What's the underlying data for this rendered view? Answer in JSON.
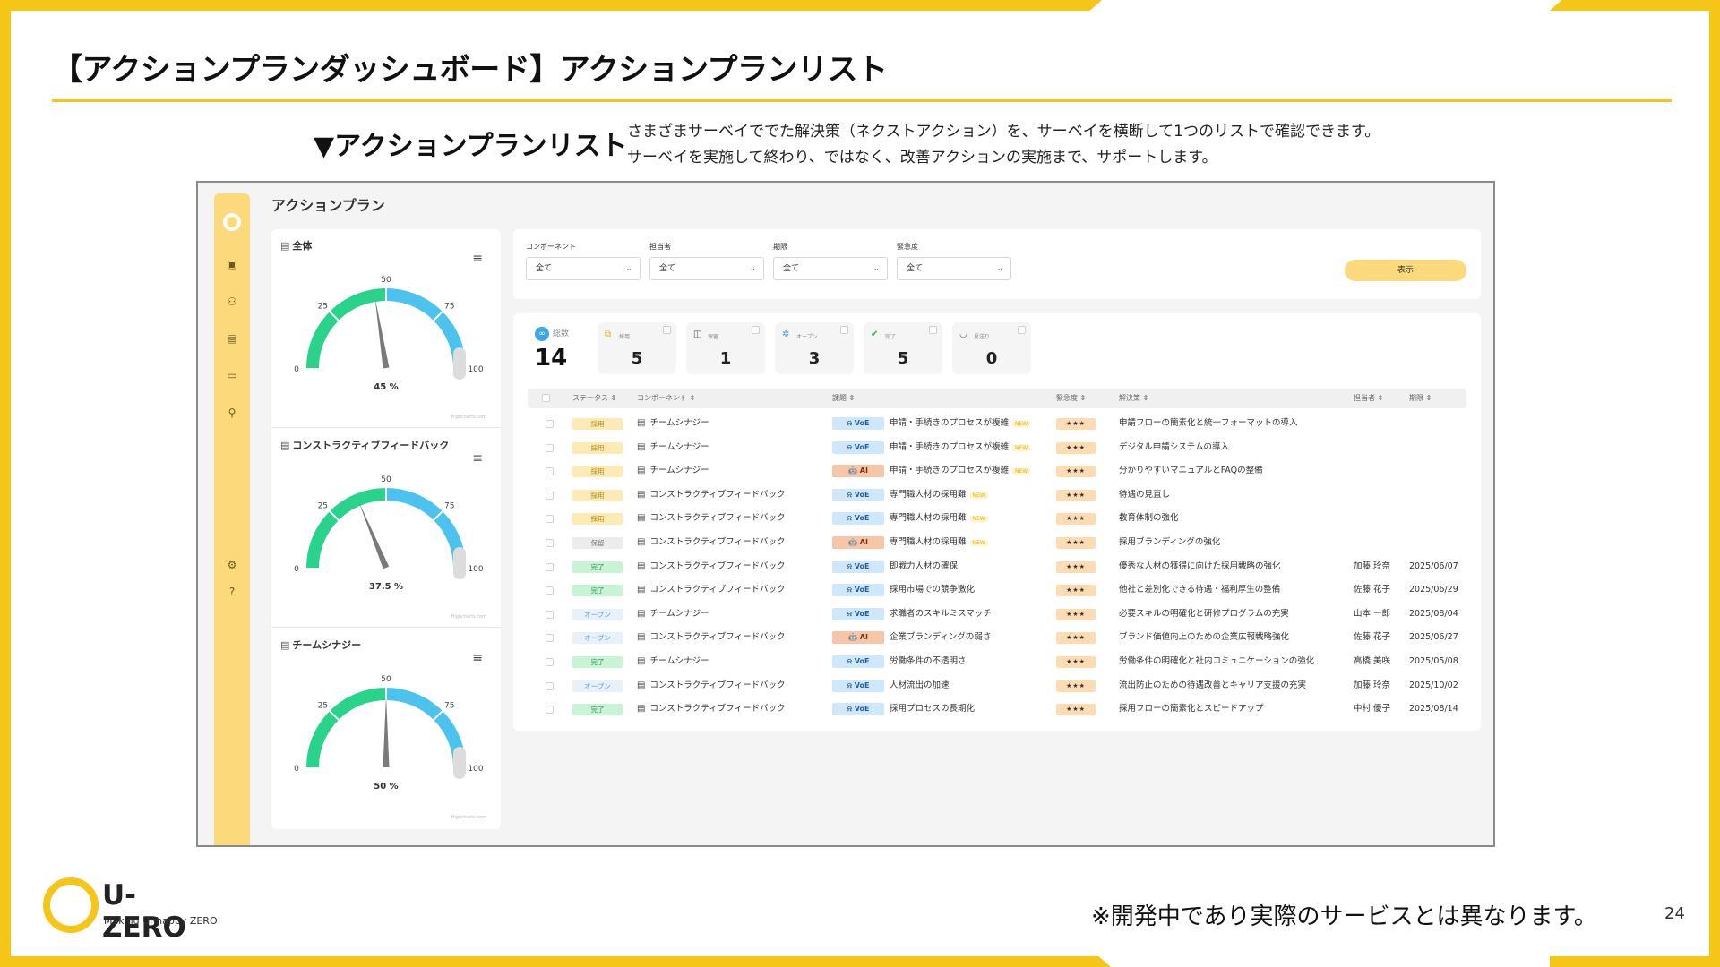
{
  "slide": {
    "title": "【アクションプランダッシュボード】アクションプランリスト",
    "section_heading": "▼アクションプランリスト",
    "description_line1": "さまざまサーベイででた解決策（ネクストアクション）を、サーベイを横断して1つのリストで確認できます。",
    "description_line2": "サーベイを実施して終わり、ではなく、改善アクションの実施まで、サポートします。",
    "footnote": "※開発中であり実際のサービスとは異なります。",
    "page_number": "24",
    "logo": {
      "name": "U-ZERO",
      "tagline": "Making Unhappy ZERO"
    }
  },
  "app": {
    "title": "アクションプラン",
    "sidebar_icons": [
      "calendar-icon",
      "group-icon",
      "survey-icon",
      "chat-icon",
      "people-search-icon",
      "gear-icon",
      "help-icon"
    ]
  },
  "gauges": [
    {
      "name": "全体",
      "value": 45,
      "label": "45 %",
      "ticks": [
        "0",
        "25",
        "50",
        "75",
        "100"
      ],
      "credit": "Highcharts.com"
    },
    {
      "name": "コンストラクティブフィードバック",
      "value": 37.5,
      "label": "37.5 %",
      "ticks": [
        "0",
        "25",
        "50",
        "75",
        "100"
      ],
      "credit": "Highcharts.com"
    },
    {
      "name": "チームシナジー",
      "value": 50,
      "label": "50 %",
      "ticks": [
        "0",
        "25",
        "50",
        "75",
        "100"
      ],
      "credit": "Highcharts.com"
    }
  ],
  "filters": [
    {
      "label": "コンポーネント",
      "value": "全て"
    },
    {
      "label": "担当者",
      "value": "全て"
    },
    {
      "label": "期限",
      "value": "全て"
    },
    {
      "label": "緊急度",
      "value": "全て"
    }
  ],
  "show_button": "表示",
  "stats": {
    "total": {
      "label": "総数",
      "value": "14"
    },
    "items": [
      {
        "label": "採用",
        "value": "5",
        "icon": "adopt-icon",
        "color": "#e8b21a"
      },
      {
        "label": "保留",
        "value": "1",
        "icon": "hold-icon",
        "color": "#555555"
      },
      {
        "label": "オープン",
        "value": "3",
        "icon": "open-icon",
        "color": "#3a9be0"
      },
      {
        "label": "完了",
        "value": "5",
        "icon": "done-icon",
        "color": "#2bb24c"
      },
      {
        "label": "見送り",
        "value": "0",
        "icon": "skip-icon",
        "color": "#555555"
      }
    ]
  },
  "table": {
    "columns": [
      "ステータス",
      "コンポーネント",
      "課題",
      "緊急度",
      "解決策",
      "担当者",
      "期限"
    ],
    "new_tag": "NEW",
    "rows": [
      {
        "status": "採用",
        "status_class": "st-saiyo",
        "component": "チームシナジー",
        "source": "VoE",
        "issue": "申請・手続きのプロセスが複雑",
        "new": true,
        "urgency": "★★★",
        "solution": "申請フローの簡素化と統一フォーマットの導入",
        "owner": "",
        "due": ""
      },
      {
        "status": "採用",
        "status_class": "st-saiyo",
        "component": "チームシナジー",
        "source": "VoE",
        "issue": "申請・手続きのプロセスが複雑",
        "new": true,
        "urgency": "★★★",
        "solution": "デジタル申請システムの導入",
        "owner": "",
        "due": ""
      },
      {
        "status": "採用",
        "status_class": "st-saiyo",
        "component": "チームシナジー",
        "source": "AI",
        "issue": "申請・手続きのプロセスが複雑",
        "new": true,
        "urgency": "★★★",
        "solution": "分かりやすいマニュアルとFAQの整備",
        "owner": "",
        "due": ""
      },
      {
        "status": "採用",
        "status_class": "st-saiyo",
        "component": "コンストラクティブフィードバック",
        "source": "VoE",
        "issue": "専門職人材の採用難",
        "new": true,
        "urgency": "★★★",
        "solution": "待遇の見直し",
        "owner": "",
        "due": ""
      },
      {
        "status": "採用",
        "status_class": "st-saiyo",
        "component": "コンストラクティブフィードバック",
        "source": "VoE",
        "issue": "専門職人材の採用難",
        "new": true,
        "urgency": "★★★",
        "solution": "教育体制の強化",
        "owner": "",
        "due": ""
      },
      {
        "status": "保留",
        "status_class": "st-horyu",
        "component": "コンストラクティブフィードバック",
        "source": "AI",
        "issue": "専門職人材の採用難",
        "new": true,
        "urgency": "★★★",
        "solution": "採用ブランディングの強化",
        "owner": "",
        "due": ""
      },
      {
        "status": "完了",
        "status_class": "st-kanryo",
        "component": "コンストラクティブフィードバック",
        "source": "VoE",
        "issue": "即戦力人材の確保",
        "new": false,
        "urgency": "★★★",
        "solution": "優秀な人材の獲得に向けた採用戦略の強化",
        "owner": "加藤 玲奈",
        "due": "2025/06/07"
      },
      {
        "status": "完了",
        "status_class": "st-kanryo",
        "component": "コンストラクティブフィードバック",
        "source": "VoE",
        "issue": "採用市場での競争激化",
        "new": false,
        "urgency": "★★★",
        "solution": "他社と差別化できる待遇・福利厚生の整備",
        "owner": "佐藤 花子",
        "due": "2025/06/29"
      },
      {
        "status": "オープン",
        "status_class": "st-open",
        "component": "チームシナジー",
        "source": "VoE",
        "issue": "求職者のスキルミスマッチ",
        "new": false,
        "urgency": "★★★",
        "solution": "必要スキルの明確化と研修プログラムの充実",
        "owner": "山本 一郎",
        "due": "2025/08/04"
      },
      {
        "status": "オープン",
        "status_class": "st-open",
        "component": "コンストラクティブフィードバック",
        "source": "AI",
        "issue": "企業ブランディングの弱さ",
        "new": false,
        "urgency": "★★★",
        "solution": "ブランド価値向上のための企業広報戦略強化",
        "owner": "佐藤 花子",
        "due": "2025/06/27"
      },
      {
        "status": "完了",
        "status_class": "st-kanryo",
        "component": "チームシナジー",
        "source": "VoE",
        "issue": "労働条件の不透明さ",
        "new": false,
        "urgency": "★★★",
        "solution": "労働条件の明確化と社内コミュニケーションの強化",
        "owner": "高橋 美咲",
        "due": "2025/05/08"
      },
      {
        "status": "オープン",
        "status_class": "st-open",
        "component": "コンストラクティブフィードバック",
        "source": "VoE",
        "issue": "人材流出の加速",
        "new": false,
        "urgency": "★★★",
        "solution": "流出防止のための待遇改善とキャリア支援の充実",
        "owner": "加藤 玲奈",
        "due": "2025/10/02"
      },
      {
        "status": "完了",
        "status_class": "st-kanryo",
        "component": "コンストラクティブフィードバック",
        "source": "VoE",
        "issue": "採用プロセスの長期化",
        "new": false,
        "urgency": "★★★",
        "solution": "採用フローの簡素化とスピードアップ",
        "owner": "中村 優子",
        "due": "2025/08/14"
      }
    ]
  }
}
